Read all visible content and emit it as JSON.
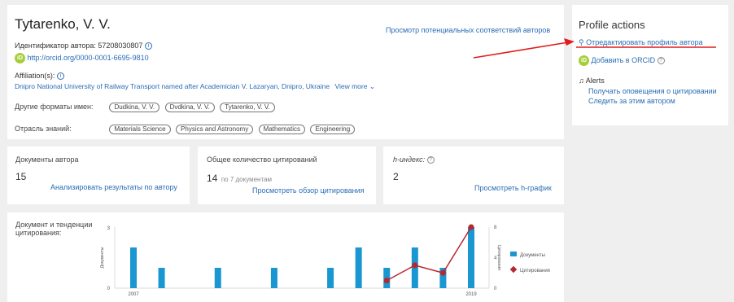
{
  "profile": {
    "name": "Tytarenko, V. V.",
    "author_id_label": "Идентификатор автора: 57208030807",
    "orcid_url": "http://orcid.org/0000-0001-6695-9810",
    "affiliation_label": "Affiliation(s):",
    "affiliation_text": "Dnipro National University of Railway Transport named after Academician V. Lazaryan, Dnipro, Ukraine",
    "view_more": "View more",
    "other_names_label": "Другие форматы имен:",
    "other_names": [
      "Dudkina, V. V.",
      "Dvdkina, V. V.",
      "Tytarenko, V. V."
    ],
    "fields_label": "Отрасль знаний:",
    "fields": [
      "Materials Science",
      "Physics and Astronomy",
      "Mathematics",
      "Engineering"
    ],
    "potential_matches_link": "Просмотр потенциальных соответствий авторов"
  },
  "actions": {
    "title": "Profile actions",
    "edit_profile": "Отредактировать профиль автора",
    "add_orcid": "Добавить в ORCID",
    "alerts": "Alerts",
    "citation_alerts": "Получать оповещения о цитировании",
    "follow_author": "Следить за этим автором"
  },
  "metrics": {
    "documents": {
      "label": "Документы автора",
      "value": "15",
      "link": "Анализировать результаты по автору"
    },
    "citations": {
      "label": "Общее количество цитирований",
      "value": "14",
      "sub": "по 7 документам",
      "link": "Просмотреть обзор цитирования"
    },
    "hindex": {
      "label": "h-индекс:",
      "value": "2",
      "link": "Просмотреть h-график"
    }
  },
  "trends": {
    "title": "Документ и тенденции цитирования:"
  },
  "chart_data": {
    "type": "bar",
    "x": [
      2007,
      2008,
      2009,
      2010,
      2011,
      2012,
      2013,
      2014,
      2015,
      2016,
      2017,
      2018,
      2019
    ],
    "x_tick_labels": [
      "2007",
      "2019"
    ],
    "left_axis_label": "Документы",
    "left_axis_ticks": [
      "3",
      "0"
    ],
    "right_axis_label": "Цитирования",
    "right_axis_ticks": [
      "8",
      "4",
      "0"
    ],
    "ylim_left": [
      0,
      3
    ],
    "ylim_right": [
      0,
      8
    ],
    "series": [
      {
        "name": "Документы",
        "type": "bar",
        "color": "#1a96d0",
        "values": [
          2,
          1,
          0,
          1,
          0,
          1,
          0,
          1,
          2,
          1,
          2,
          1,
          3
        ]
      },
      {
        "name": "Цитирования",
        "type": "line",
        "color": "#b7272f",
        "x": [
          2016,
          2017,
          2018,
          2019
        ],
        "values": [
          1,
          3,
          2,
          8
        ]
      }
    ],
    "legend_position": "right"
  }
}
